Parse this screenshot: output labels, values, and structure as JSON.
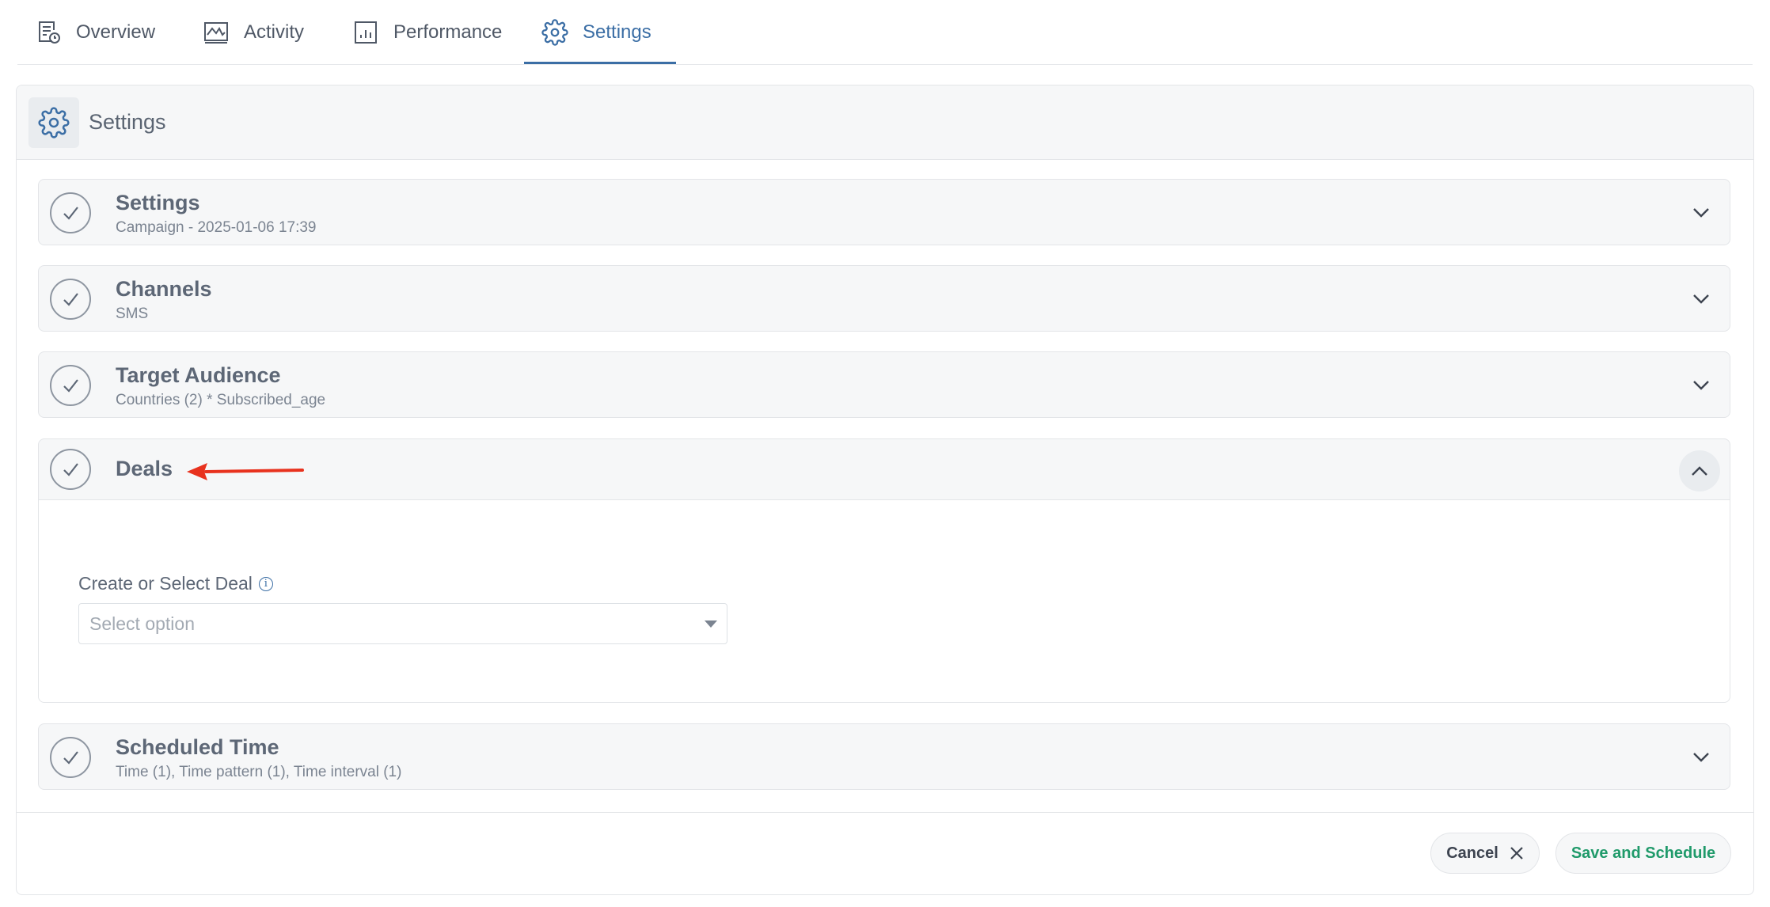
{
  "tabs": [
    {
      "label": "Overview",
      "icon": "report-icon"
    },
    {
      "label": "Activity",
      "icon": "activity-icon"
    },
    {
      "label": "Performance",
      "icon": "chart-icon"
    },
    {
      "label": "Settings",
      "icon": "gear-icon",
      "active": true
    }
  ],
  "panel": {
    "title": "Settings",
    "icon": "gear-icon"
  },
  "sections": [
    {
      "title": "Settings",
      "subtitle": "Campaign - 2025-01-06 17:39"
    },
    {
      "title": "Channels",
      "subtitle": "SMS"
    },
    {
      "title": "Target Audience",
      "subtitle": "Countries (2) * Subscribed_age"
    },
    {
      "title": "Deals",
      "subtitle": "",
      "expanded": true
    },
    {
      "title": "Scheduled Time",
      "subtitle": "Time (1), Time pattern (1), Time interval (1)"
    }
  ],
  "deals": {
    "field_label": "Create or Select Deal",
    "info_glyph": "i",
    "select_placeholder": "Select option"
  },
  "footer": {
    "cancel_label": "Cancel",
    "save_label": "Save and Schedule"
  },
  "colors": {
    "accent": "#3b6ea5",
    "save_text": "#1f9a6a",
    "annotation_arrow": "#e8321e"
  }
}
